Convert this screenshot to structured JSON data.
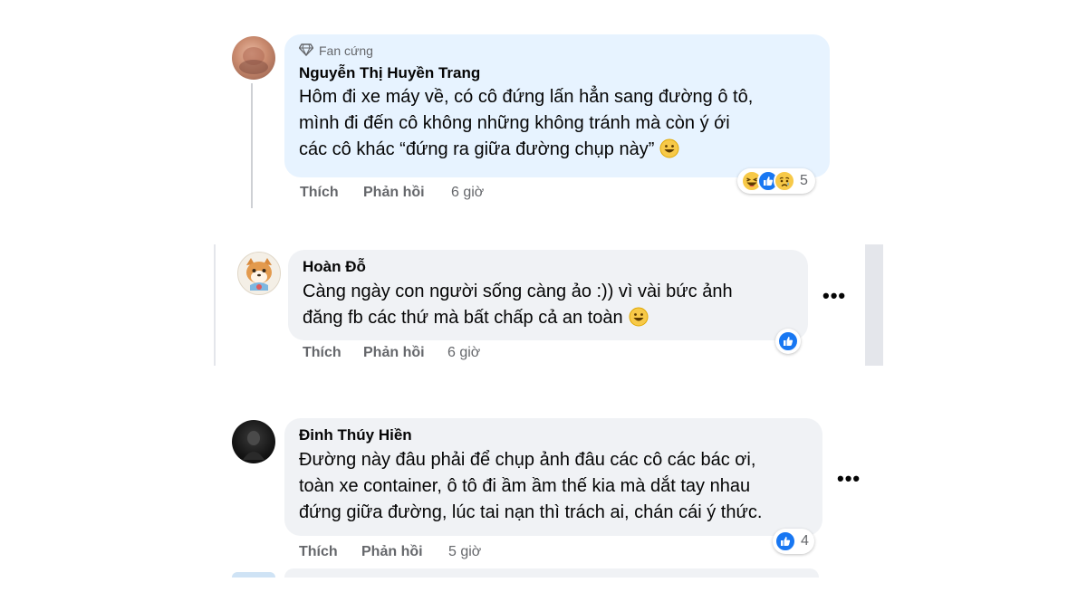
{
  "comments": [
    {
      "badge": "Fan cứng",
      "author": "Nguyễn Thị Huyền Trang",
      "lines": [
        "Hôm đi xe máy về, có cô đứng lấn hẳn sang đường ô tô,",
        "mình đi đến cô không những không tránh mà còn ý ới",
        "các cô khác “đứng ra giữa đường chụp này”"
      ],
      "like": "Thích",
      "reply": "Phản hồi",
      "time": "6 giờ",
      "reaction_count": "5",
      "reactions": [
        "haha-icon",
        "like-icon",
        "sad-icon"
      ]
    },
    {
      "author": "Hoàn Đỗ",
      "lines": [
        "Càng ngày con người sống càng ảo :)) vì vài bức ảnh",
        "đăng fb các thứ mà bất chấp cả an toàn"
      ],
      "like": "Thích",
      "reply": "Phản hồi",
      "time": "6 giờ",
      "reactions": [
        "like-icon"
      ]
    },
    {
      "author": "Đinh Thúy Hiền",
      "lines": [
        "Đường này đâu phải để chụp ảnh đâu các cô các bác ơi,",
        "toàn xe container, ô tô đi ầm ầm thế kia mà dắt tay nhau",
        "đứng giữa đường, lúc tai nạn thì trách ai, chán cái ý thức."
      ],
      "like": "Thích",
      "reply": "Phản hồi",
      "time": "5 giờ",
      "reaction_count": "4",
      "reactions": [
        "like-icon"
      ]
    }
  ],
  "more_label": "•••",
  "colors": {
    "bubble_first": "#e7f3ff",
    "bubble": "#f0f2f5",
    "like_blue": "#1877f2",
    "secondary_text": "#65676b"
  }
}
